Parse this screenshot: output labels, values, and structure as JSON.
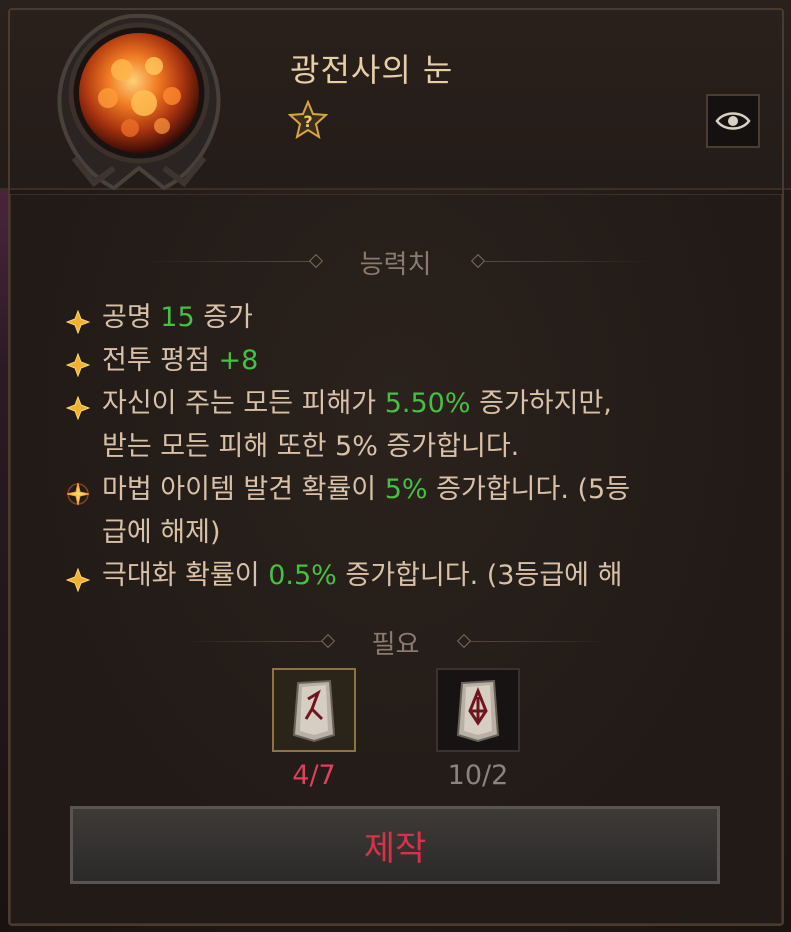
{
  "item": {
    "name": "광전사의 눈",
    "rank_icon": "rank-unknown-star-icon"
  },
  "sections": {
    "stats_header": "능력치",
    "requirements_header": "필요"
  },
  "stats": [
    {
      "icon": "gold-diamond-bullet-icon",
      "parts": [
        {
          "t": "공명 "
        },
        {
          "t": "15",
          "g": true
        },
        {
          "t": " 증가"
        }
      ]
    },
    {
      "icon": "gold-diamond-bullet-icon",
      "parts": [
        {
          "t": "전투 평점 "
        },
        {
          "t": "+8",
          "g": true
        }
      ]
    },
    {
      "icon": "gold-diamond-bullet-icon",
      "parts": [
        {
          "t": "자신이 주는 모든 피해가 "
        },
        {
          "t": "5.50%",
          "g": true
        },
        {
          "t": " 증가하지만,"
        }
      ]
    },
    {
      "icon": "",
      "parts": [
        {
          "t": "받는 모든 피해 또한 5% 증가합니다."
        }
      ]
    },
    {
      "icon": "sparkle-bullet-icon",
      "parts": [
        {
          "t": "마법 아이템 발견 확률이 "
        },
        {
          "t": "5%",
          "g": true
        },
        {
          "t": " 증가합니다. (5등"
        }
      ]
    },
    {
      "icon": "",
      "parts": [
        {
          "t": "급에 해제)"
        }
      ]
    },
    {
      "icon": "gold-diamond-bullet-icon",
      "parts": [
        {
          "t": "극대화 확률이 "
        },
        {
          "t": "0.5%",
          "g": true
        },
        {
          "t": " 증가합니다. (3등급에 해"
        }
      ]
    }
  ],
  "requirements": [
    {
      "icon": "rune-stone-icon",
      "count": "4/7",
      "count_color": "#e0405a",
      "selected": true
    },
    {
      "icon": "rune-stone-icon",
      "count": "10/2",
      "count_color": "#8a8480",
      "selected": false
    }
  ],
  "buttons": {
    "craft_label": "제작",
    "inspect_icon": "eye-icon"
  },
  "colors": {
    "accent_green": "#46c040",
    "craft_red": "#d6324a",
    "title_gold": "#e6cfa8"
  }
}
